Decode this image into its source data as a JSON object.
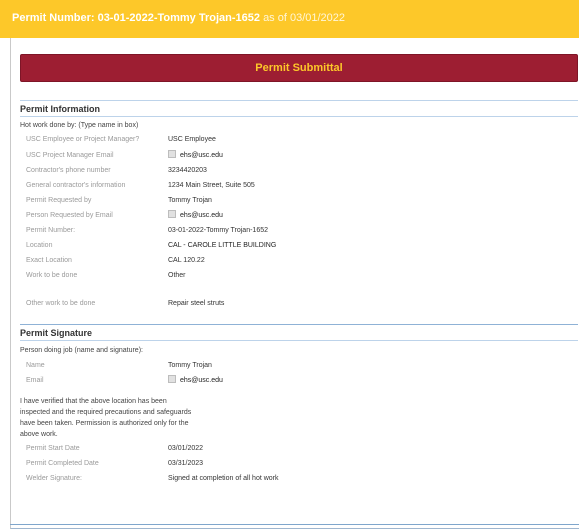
{
  "header": {
    "title": "Permit Number: 03-01-2022-Tommy Trojan-1652",
    "date_suffix": "as of 03/01/2022"
  },
  "submit_button": {
    "label": "Permit Submittal"
  },
  "permit_information": {
    "title": "Permit Information",
    "intro": "Hot work done by: (Type name in box)",
    "rows": [
      {
        "label": "USC Employee or Project Manager?",
        "value": "USC Employee"
      },
      {
        "label": "USC Project Manager Email",
        "value": "ehs@usc.edu",
        "icon": "email-icon"
      },
      {
        "label": "Contractor's phone number",
        "value": "3234420203"
      },
      {
        "label": "General contractor's information",
        "value": "1234 Main Street, Suite 505"
      },
      {
        "label": "Permit Requested by",
        "value": "Tommy Trojan"
      },
      {
        "label": "Person Requested by Email",
        "value": "ehs@usc.edu",
        "icon": "email-icon"
      },
      {
        "label": "Permit Number:",
        "value": "03-01-2022-Tommy Trojan-1652"
      },
      {
        "label": "Location",
        "value": "CAL - CAROLE LITTLE BUILDING"
      },
      {
        "label": "Exact Location",
        "value": "CAL 120.22"
      },
      {
        "label": "Work to be done",
        "value": "Other"
      },
      {
        "label": "Other work to be done",
        "value": "Repair steel struts"
      }
    ]
  },
  "permit_signature": {
    "title": "Permit Signature",
    "intro": "Person doing job (name and signature):",
    "rows": [
      {
        "label": "Name",
        "value": "Tommy Trojan"
      },
      {
        "label": "Email",
        "value": "ehs@usc.edu",
        "icon": "email-icon"
      }
    ],
    "verification_lines": [
      "I have verified that the above location has been",
      "inspected and the required precautions and safeguards",
      "have been taken. Permission is authorized only for the",
      "above work."
    ],
    "dates": [
      {
        "label": "Permit Start Date",
        "value": "03/01/2022"
      },
      {
        "label": "Permit Completed Date",
        "value": "03/31/2023"
      },
      {
        "label": "Welder Signature:",
        "value": "Signed at completion of all hot work"
      }
    ]
  }
}
